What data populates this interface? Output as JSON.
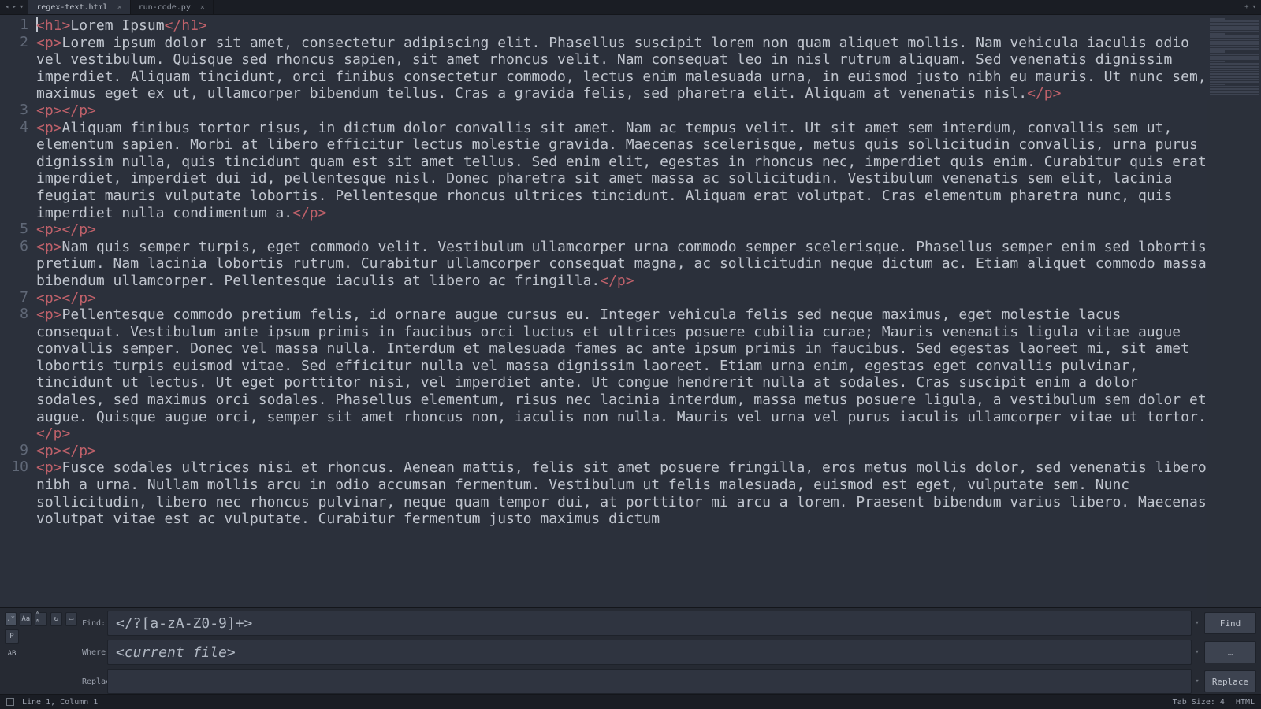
{
  "tabs": [
    {
      "label": "regex-text.html",
      "active": true
    },
    {
      "label": "run-code.py",
      "active": false
    }
  ],
  "tabbar_icons": {
    "back": "◂",
    "fwd": "▸",
    "down": "▾",
    "plus": "+",
    "down2": "▾"
  },
  "editor": {
    "lines": [
      {
        "n": "1",
        "segs": [
          {
            "t": "tag",
            "v": "<h1>"
          },
          {
            "t": "txt",
            "v": "Lorem Ipsum"
          },
          {
            "t": "tag",
            "v": "</h1>"
          }
        ]
      },
      {
        "n": "2",
        "segs": [
          {
            "t": "tag",
            "v": "<p>"
          },
          {
            "t": "txt",
            "v": "Lorem ipsum dolor sit amet, consectetur adipiscing elit. Phasellus suscipit lorem non quam aliquet mollis. Nam vehicula iaculis odio vel vestibulum. Quisque sed rhoncus sapien, sit amet rhoncus velit. Nam consequat leo in nisl rutrum aliquam. Sed venenatis dignissim imperdiet. Aliquam tincidunt, orci finibus consectetur commodo, lectus enim malesuada urna, in euismod justo nibh eu mauris. Ut nunc sem, maximus eget ex ut, ullamcorper bibendum tellus. Cras a gravida felis, sed pharetra elit. Aliquam at venenatis nisl."
          },
          {
            "t": "tag",
            "v": "</p>"
          }
        ]
      },
      {
        "n": "3",
        "segs": [
          {
            "t": "tag",
            "v": "<p>"
          },
          {
            "t": "tag",
            "v": "</p>"
          }
        ]
      },
      {
        "n": "4",
        "segs": [
          {
            "t": "tag",
            "v": "<p>"
          },
          {
            "t": "txt",
            "v": "Aliquam finibus tortor risus, in dictum dolor convallis sit amet. Nam ac tempus velit. Ut sit amet sem interdum, convallis sem ut, elementum sapien. Morbi at libero efficitur lectus molestie gravida. Maecenas scelerisque, metus quis sollicitudin convallis, urna purus dignissim nulla, quis tincidunt quam est sit amet tellus. Sed enim elit, egestas in rhoncus nec, imperdiet quis enim. Curabitur quis erat imperdiet, imperdiet dui id, pellentesque nisl. Donec pharetra sit amet massa ac sollicitudin. Vestibulum venenatis sem elit, lacinia feugiat mauris vulputate lobortis. Pellentesque rhoncus ultrices tincidunt. Aliquam erat volutpat. Cras elementum pharetra nunc, quis imperdiet nulla condimentum a."
          },
          {
            "t": "tag",
            "v": "</p>"
          }
        ]
      },
      {
        "n": "5",
        "segs": [
          {
            "t": "tag",
            "v": "<p>"
          },
          {
            "t": "tag",
            "v": "</p>"
          }
        ]
      },
      {
        "n": "6",
        "segs": [
          {
            "t": "tag",
            "v": "<p>"
          },
          {
            "t": "txt",
            "v": "Nam quis semper turpis, eget commodo velit. Vestibulum ullamcorper urna commodo semper scelerisque. Phasellus semper enim sed lobortis pretium. Nam lacinia lobortis rutrum. Curabitur ullamcorper consequat magna, ac sollicitudin neque dictum ac. Etiam aliquet commodo massa bibendum ullamcorper. Pellentesque iaculis at libero ac fringilla."
          },
          {
            "t": "tag",
            "v": "</p>"
          }
        ]
      },
      {
        "n": "7",
        "segs": [
          {
            "t": "tag",
            "v": "<p>"
          },
          {
            "t": "tag",
            "v": "</p>"
          }
        ]
      },
      {
        "n": "8",
        "segs": [
          {
            "t": "tag",
            "v": "<p>"
          },
          {
            "t": "txt",
            "v": "Pellentesque commodo pretium felis, id ornare augue cursus eu. Integer vehicula felis sed neque maximus, eget molestie lacus consequat. Vestibulum ante ipsum primis in faucibus orci luctus et ultrices posuere cubilia curae; Mauris venenatis ligula vitae augue convallis semper. Donec vel massa nulla. Interdum et malesuada fames ac ante ipsum primis in faucibus. Sed egestas laoreet mi, sit amet lobortis turpis euismod vitae. Sed efficitur nulla vel massa dignissim laoreet. Etiam urna enim, egestas eget convallis pulvinar, tincidunt ut lectus. Ut eget porttitor nisi, vel imperdiet ante. Ut congue hendrerit nulla at sodales. Cras suscipit enim a dolor sodales, sed maximus orci sodales. Phasellus elementum, risus nec lacinia interdum, massa metus posuere ligula, a vestibulum sem dolor et augue. Quisque augue orci, semper sit amet rhoncus non, iaculis non nulla. Mauris vel urna vel purus iaculis ullamcorper vitae ut tortor."
          },
          {
            "t": "tag",
            "v": "</p>"
          }
        ]
      },
      {
        "n": "9",
        "segs": [
          {
            "t": "tag",
            "v": "<p>"
          },
          {
            "t": "tag",
            "v": "</p>"
          }
        ]
      },
      {
        "n": "10",
        "segs": [
          {
            "t": "tag",
            "v": "<p>"
          },
          {
            "t": "txt",
            "v": "Fusce sodales ultrices nisi et rhoncus. Aenean mattis, felis sit amet posuere fringilla, eros metus mollis dolor, sed venenatis libero nibh a urna. Nullam mollis arcu in odio accumsan fermentum. Vestibulum ut felis malesuada, euismod est eget, vulputate sem. Nunc sollicitudin, libero nec rhoncus pulvinar, neque quam tempor dui, at porttitor mi arcu a lorem. Praesent bibendum varius libero. Maecenas volutpat vitae est ac vulputate. Curabitur fermentum justo maximus dictum"
          }
        ]
      }
    ]
  },
  "find": {
    "options": {
      "regex": ".*",
      "case": "Aa",
      "word": "“ ”",
      "wrap": "↻",
      "sel": "▭",
      "preserve": "P",
      "hl": "AB"
    },
    "find_label": "Find:",
    "find_value": "</?[a-zA-Z0-9]+>",
    "where_label": "Where:",
    "where_value": "<current file>",
    "replace_label": "Replace:",
    "replace_value": "",
    "btn_find": "Find",
    "btn_where": "…",
    "btn_replace": "Replace",
    "dd": "▾"
  },
  "status": {
    "selection": "Line 1, Column 1",
    "tab_size": "Tab Size: 4",
    "syntax": "HTML"
  }
}
